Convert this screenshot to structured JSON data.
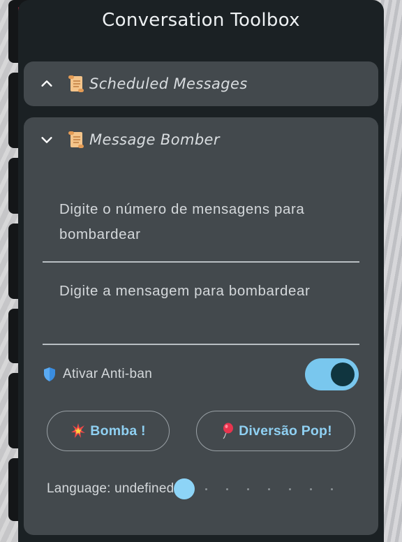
{
  "panel": {
    "title": "Conversation Toolbox"
  },
  "sections": [
    {
      "title": "Scheduled Messages",
      "state": "collapsed",
      "chevron": "chevron-up-icon",
      "icon": "scroll-icon"
    },
    {
      "title": "Message Bomber",
      "state": "expanded",
      "chevron": "chevron-down-icon",
      "icon": "scroll-icon"
    }
  ],
  "bomber": {
    "count_placeholder": "Digite o número de mensagens para bombardear",
    "message_placeholder": "Digite a mensagem para bombardear",
    "antiban_label": "Ativar Anti-ban",
    "antiban_enabled": true,
    "bomb_button": "Bomba !",
    "pop_button": "Diversão Pop!",
    "language_label": "Language: undefined",
    "language_slider": {
      "steps": 8,
      "value": 0
    }
  },
  "colors": {
    "panel_bg": "#1b2124",
    "card_bg": "#43494d",
    "accent": "#79c7ee",
    "button_text": "#8fd0f2"
  }
}
